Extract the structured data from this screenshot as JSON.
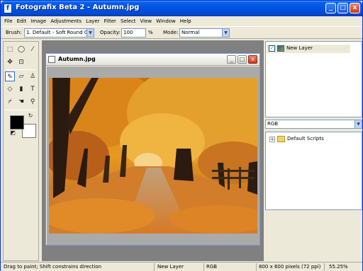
{
  "window": {
    "title": "Fotografix Beta 2 - Autumn.jpg",
    "app_icon": "f",
    "minimize": "_",
    "maximize": "□",
    "close": "x"
  },
  "menu": [
    "File",
    "Edit",
    "Image",
    "Adjustments",
    "Layer",
    "Filter",
    "Select",
    "View",
    "Window",
    "Help"
  ],
  "options": {
    "brush_label": "Brush:",
    "brush_value": "1. Default - Soft Round G",
    "opacity_label": "Opacity:",
    "opacity_value": "100",
    "opacity_unit": "%",
    "mode_label": "Mode:",
    "mode_value": "Normal"
  },
  "tools": [
    {
      "name": "rect-select-icon",
      "glyph": "⬚"
    },
    {
      "name": "ellipse-select-icon",
      "glyph": "◯"
    },
    {
      "name": "magic-wand-icon",
      "glyph": "⁄"
    },
    {
      "name": "move-icon",
      "glyph": "✥"
    },
    {
      "name": "crop-icon",
      "glyph": "⊡"
    },
    {
      "name": "brush-icon",
      "glyph": "✎"
    },
    {
      "name": "eraser-icon",
      "glyph": "▱"
    },
    {
      "name": "clone-stamp-icon",
      "glyph": "♙"
    },
    {
      "name": "fill-bucket-icon",
      "glyph": "◇"
    },
    {
      "name": "gradient-icon",
      "glyph": "▮"
    },
    {
      "name": "text-icon",
      "glyph": "T"
    },
    {
      "name": "eyedropper-icon",
      "glyph": "⌿"
    },
    {
      "name": "hand-icon",
      "glyph": "☚"
    },
    {
      "name": "zoom-icon",
      "glyph": "⚲"
    }
  ],
  "colors": {
    "foreground": "#000000",
    "background": "#ffffff",
    "swap_glyph": "↻",
    "reset_glyph": "◩"
  },
  "document": {
    "title": "Autumn.jpg"
  },
  "layers": [
    {
      "name": "New Layer",
      "visible": true
    }
  ],
  "channel_mode": "RGB",
  "scripts": [
    {
      "name": "Default Scripts",
      "expander": "+"
    }
  ],
  "status": {
    "hint": "Drag to paint; Shift constrains direction",
    "layer": "New Layer",
    "mode": "RGB",
    "size": "800 x 600 pixels (72 ppi)",
    "zoom": "55.25%"
  },
  "palette": {
    "titlebar": "#0053e1",
    "accent": "#316ac5",
    "canvas_bg": "#808080",
    "chrome": "#ece9d8"
  }
}
